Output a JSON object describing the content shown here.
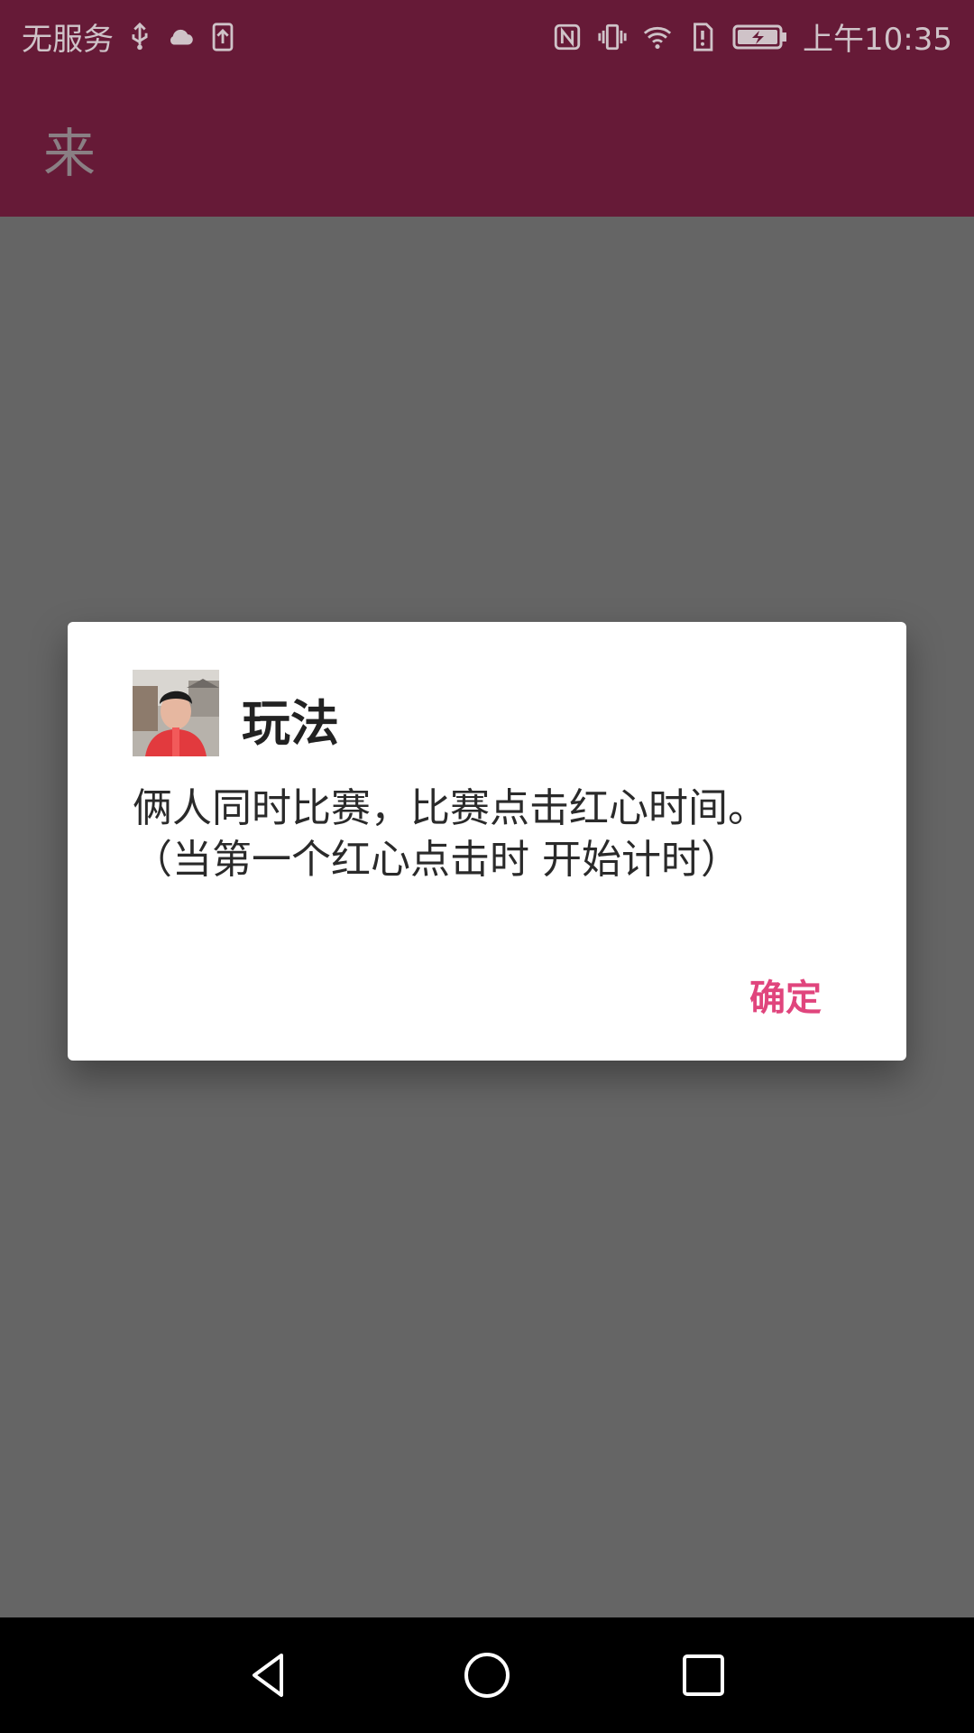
{
  "status_bar": {
    "carrier": "无服务",
    "time": "上午10:35",
    "icons": [
      "usb-icon",
      "cloud-icon",
      "upload-icon",
      "nfc-icon",
      "vibrate-icon",
      "wifi-icon",
      "sim-alert-icon",
      "battery-charging-icon"
    ]
  },
  "app_bar": {
    "title": "来"
  },
  "dialog": {
    "title": "玩法",
    "message": "俩人同时比赛，比赛点击红心时间。\n（当第一个红心点击时 开始计时）",
    "ok_label": "确定"
  },
  "nav_bar": {
    "buttons": [
      "back-icon",
      "home-icon",
      "recents-icon"
    ]
  },
  "colors": {
    "primary": "#661a37",
    "accent": "#e0457d",
    "scrim": "#656565"
  }
}
